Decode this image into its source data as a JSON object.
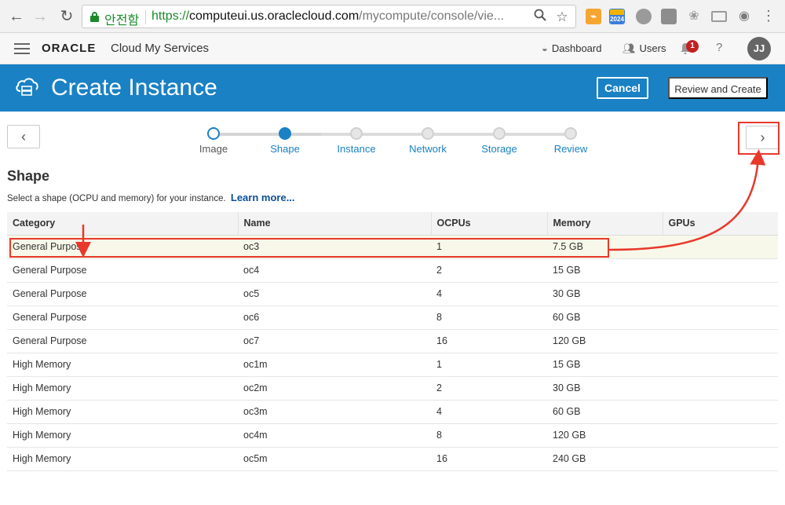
{
  "browser": {
    "secure_label": "안전함",
    "url_proto": "https://",
    "url_host": "computeui.us.oraclecloud.com",
    "url_path": "/mycompute/console/vie...",
    "extension_badge": "2024"
  },
  "header": {
    "logo": "ORACLE",
    "service": "Cloud My Services",
    "dashboard_label": "Dashboard",
    "users_label": "Users",
    "notification_count": "1",
    "help_label": "?",
    "avatar_initials": "JJ"
  },
  "banner": {
    "title": "Create Instance",
    "cancel_label": "Cancel",
    "review_label": "Review and Create",
    "color": "#1a81c4"
  },
  "train": {
    "steps": [
      {
        "label": "Image",
        "state": "visited"
      },
      {
        "label": "Shape",
        "state": "current"
      },
      {
        "label": "Instance",
        "state": "unvisited"
      },
      {
        "label": "Network",
        "state": "unvisited"
      },
      {
        "label": "Storage",
        "state": "unvisited"
      },
      {
        "label": "Review",
        "state": "unvisited"
      }
    ]
  },
  "section": {
    "title": "Shape",
    "description": "Select a shape (OCPU and memory) for your instance.",
    "learn_more": "Learn more..."
  },
  "table": {
    "columns": [
      "Category",
      "Name",
      "OCPUs",
      "Memory",
      "GPUs"
    ],
    "rows": [
      {
        "category": "General Purpose",
        "name": "oc3",
        "ocpus": "1",
        "memory": "7.5 GB",
        "gpus": "",
        "selected": true
      },
      {
        "category": "General Purpose",
        "name": "oc4",
        "ocpus": "2",
        "memory": "15 GB",
        "gpus": ""
      },
      {
        "category": "General Purpose",
        "name": "oc5",
        "ocpus": "4",
        "memory": "30 GB",
        "gpus": ""
      },
      {
        "category": "General Purpose",
        "name": "oc6",
        "ocpus": "8",
        "memory": "60 GB",
        "gpus": ""
      },
      {
        "category": "General Purpose",
        "name": "oc7",
        "ocpus": "16",
        "memory": "120 GB",
        "gpus": ""
      },
      {
        "category": "High Memory",
        "name": "oc1m",
        "ocpus": "1",
        "memory": "15 GB",
        "gpus": ""
      },
      {
        "category": "High Memory",
        "name": "oc2m",
        "ocpus": "2",
        "memory": "30 GB",
        "gpus": ""
      },
      {
        "category": "High Memory",
        "name": "oc3m",
        "ocpus": "4",
        "memory": "60 GB",
        "gpus": ""
      },
      {
        "category": "High Memory",
        "name": "oc4m",
        "ocpus": "8",
        "memory": "120 GB",
        "gpus": ""
      },
      {
        "category": "High Memory",
        "name": "oc5m",
        "ocpus": "16",
        "memory": "240 GB",
        "gpus": ""
      }
    ]
  },
  "annotation_color": "#e8392b"
}
